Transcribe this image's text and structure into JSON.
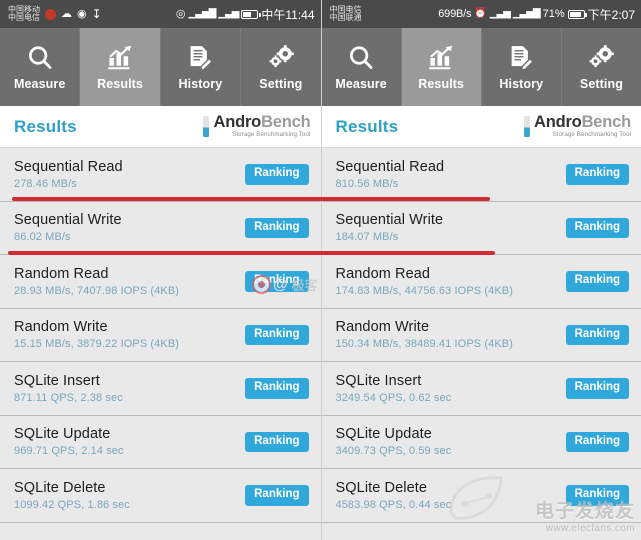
{
  "panels": [
    {
      "id": "left",
      "statusbar": {
        "carrier_line1": "中国移动",
        "carrier_line2": "中国电信",
        "netspeed": "",
        "battery_percent": "",
        "clock": "中午11:44",
        "icons": [
          "record-icon",
          "cloud-icon",
          "camera-icon",
          "download-icon",
          "wifi-icon",
          "signal-icon",
          "signal2-icon",
          "battery-icon"
        ]
      },
      "tabs": [
        {
          "label": "Measure",
          "icon": "magnifier-icon",
          "active": false
        },
        {
          "label": "Results",
          "icon": "bar-chart-icon",
          "active": true
        },
        {
          "label": "History",
          "icon": "document-pen-icon",
          "active": false
        },
        {
          "label": "Setting",
          "icon": "gears-icon",
          "active": false
        }
      ],
      "header": {
        "title": "Results",
        "logo_main_a": "Andro",
        "logo_main_b": "Bench",
        "logo_sub": "Storage Benchmarking Tool"
      },
      "rows": [
        {
          "name": "Sequential Read",
          "value": "278.46 MB/s",
          "button": "Ranking"
        },
        {
          "name": "Sequential Write",
          "value": "86.02 MB/s",
          "button": "Ranking"
        },
        {
          "name": "Random Read",
          "value": "28.93 MB/s, 7407.98 IOPS (4KB)",
          "button": "Ranking"
        },
        {
          "name": "Random Write",
          "value": "15.15 MB/s, 3879.22 IOPS (4KB)",
          "button": "Ranking"
        },
        {
          "name": "SQLite Insert",
          "value": "871.11 QPS, 2.38 sec",
          "button": "Ranking"
        },
        {
          "name": "SQLite Update",
          "value": "969.71 QPS, 2.14 sec",
          "button": "Ranking"
        },
        {
          "name": "SQLite Delete",
          "value": "1099.42 QPS, 1.86 sec",
          "button": "Ranking"
        }
      ]
    },
    {
      "id": "right",
      "statusbar": {
        "carrier_line1": "中国电信",
        "carrier_line2": "中国联通",
        "netspeed": "699B/s",
        "battery_percent": "71%",
        "clock": "下午2:07",
        "icons": [
          "alarm-icon",
          "signal-icon",
          "signal2-icon",
          "battery-icon"
        ]
      },
      "tabs": [
        {
          "label": "Measure",
          "icon": "magnifier-icon",
          "active": false
        },
        {
          "label": "Results",
          "icon": "bar-chart-icon",
          "active": true
        },
        {
          "label": "History",
          "icon": "document-pen-icon",
          "active": false
        },
        {
          "label": "Setting",
          "icon": "gears-icon",
          "active": false
        }
      ],
      "header": {
        "title": "Results",
        "logo_main_a": "Andro",
        "logo_main_b": "Bench",
        "logo_sub": "Storage Benchmarking Tool"
      },
      "rows": [
        {
          "name": "Sequential Read",
          "value": "810.56 MB/s",
          "button": "Ranking"
        },
        {
          "name": "Sequential Write",
          "value": "184.07 MB/s",
          "button": "Ranking"
        },
        {
          "name": "Random Read",
          "value": "174.83 MB/s, 44756.63 IOPS (4KB)",
          "button": "Ranking"
        },
        {
          "name": "Random Write",
          "value": "150.34 MB/s, 38489.41 IOPS (4KB)",
          "button": "Ranking"
        },
        {
          "name": "SQLite Insert",
          "value": "3249.54 QPS, 0.62 sec",
          "button": "Ranking"
        },
        {
          "name": "SQLite Update",
          "value": "3409.73 QPS, 0.59 sec",
          "button": "Ranking"
        },
        {
          "name": "SQLite Delete",
          "value": "4583.98 QPS, 0.44 sec",
          "button": "Ranking"
        }
      ]
    }
  ],
  "watermarks": {
    "weibo_at": "@",
    "weibo_cn": "极客",
    "elecfans_cn": "电子发烧友",
    "elecfans_url": "www.elecfans.com"
  },
  "colors": {
    "accent_blue": "#31a8dc",
    "title_teal": "#2f9fc4",
    "annotation_red": "#d32a36",
    "tabbar_gray": "#6e6e6e",
    "tab_active_gray": "#9a9a9a",
    "row_bg": "#e9e9e9",
    "value_text": "#79a7bd",
    "statusbar_gray": "#4a4a4a"
  }
}
